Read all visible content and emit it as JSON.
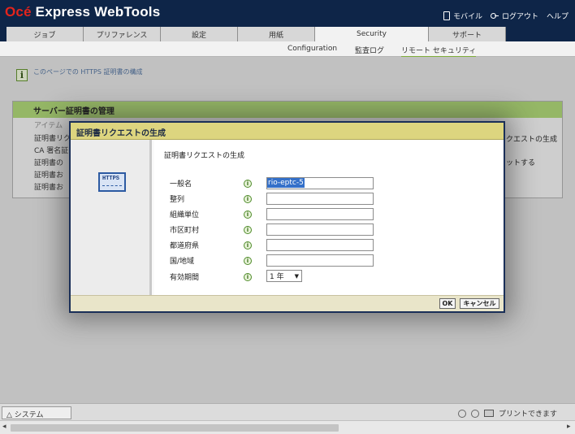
{
  "app": {
    "brand_oce": "Océ",
    "brand_rest": " Express WebTools"
  },
  "top_links": {
    "mobile": "モバイル",
    "logout": "ログアウト",
    "help": "ヘルプ"
  },
  "tabs": [
    {
      "label": "ジョブ"
    },
    {
      "label": "プリファレンス"
    },
    {
      "label": "設定"
    },
    {
      "label": "用紙"
    },
    {
      "label": "Security"
    },
    {
      "label": "サポート"
    }
  ],
  "subnav": [
    {
      "label": "Configuration"
    },
    {
      "label": "監査ログ"
    },
    {
      "label": "リモート セキュリティ"
    }
  ],
  "info": {
    "text": "このページでの HTTPS 証明書の構成"
  },
  "panel": {
    "title": "サーバー証明書の管理",
    "column_header": "アイテム",
    "rows": [
      "証明書リク",
      "CA 署名証",
      "証明書の",
      "証明書お",
      "証明書お"
    ],
    "right_actions": [
      "クエストの生成",
      "ットする"
    ]
  },
  "dialog": {
    "title": "証明書リクエストの生成",
    "heading": "証明書リクエストの生成",
    "badge_text": "HTTPS",
    "fields": [
      {
        "label": "一般名",
        "value": "rio-eptc-5"
      },
      {
        "label": "整列",
        "value": ""
      },
      {
        "label": "組織単位",
        "value": ""
      },
      {
        "label": "市区町村",
        "value": ""
      },
      {
        "label": "都道府県",
        "value": ""
      },
      {
        "label": "国/地域",
        "value": ""
      }
    ],
    "validity": {
      "label": "有効期間",
      "selected": "1 年",
      "caret": "▼"
    },
    "help_glyph": "i",
    "ok_label": "OK",
    "cancel_label": "キャンセル"
  },
  "statusbar": {
    "system_tab": "△ システム",
    "printer_status": "プリントできます"
  },
  "scroll": {
    "left": "◂",
    "right": "▸"
  }
}
